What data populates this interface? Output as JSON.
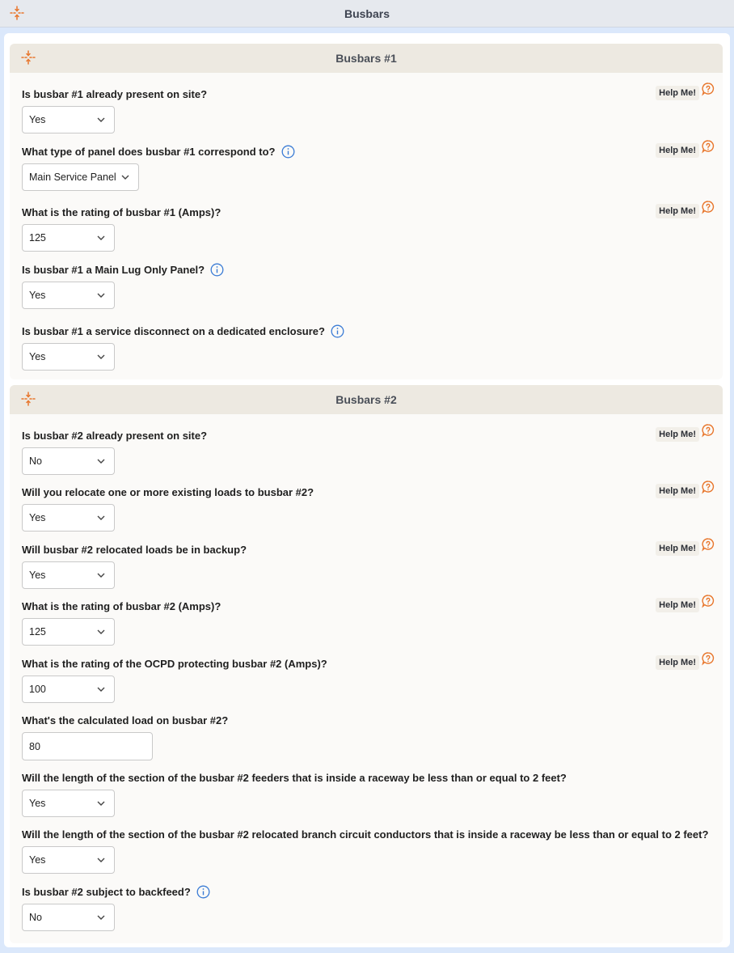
{
  "page": {
    "title": "Busbars"
  },
  "help_label": "Help Me!",
  "sections": [
    {
      "title": "Busbars #1",
      "questions": [
        {
          "label": "Is busbar #1 already present on site?",
          "value": "Yes",
          "help": true,
          "info": false
        },
        {
          "label": "What type of panel does busbar #1 correspond to?",
          "value": "Main Service Panel",
          "help": true,
          "info": true
        },
        {
          "label": "What is the rating of busbar #1 (Amps)?",
          "value": "125",
          "help": true,
          "info": false
        },
        {
          "label": "Is busbar #1 a Main Lug Only Panel?",
          "value": "Yes",
          "help": false,
          "info": true
        },
        {
          "label": "Is busbar #1 a service disconnect on a dedicated enclosure?",
          "value": "Yes",
          "help": false,
          "info": true
        }
      ]
    },
    {
      "title": "Busbars #2",
      "questions": [
        {
          "label": "Is busbar #2 already present on site?",
          "value": "No",
          "help": true,
          "info": false
        },
        {
          "label": "Will you relocate one or more existing loads to busbar #2?",
          "value": "Yes",
          "help": true,
          "info": false
        },
        {
          "label": "Will busbar #2 relocated loads be in backup?",
          "value": "Yes",
          "help": true,
          "info": false
        },
        {
          "label": "What is the rating of busbar #2 (Amps)?",
          "value": "125",
          "help": true,
          "info": false
        },
        {
          "label": "What is the rating of the OCPD protecting busbar #2 (Amps)?",
          "value": "100",
          "help": true,
          "info": false
        },
        {
          "label": "What's the calculated load on busbar #2?",
          "value": "80",
          "help": false,
          "info": false,
          "input_type": "text"
        },
        {
          "label": "Will the length of the section of the busbar #2 feeders that is inside a raceway be less than or equal to 2 feet?",
          "value": "Yes",
          "help": false,
          "info": false
        },
        {
          "label": "Will the length of the section of the busbar #2 relocated branch circuit conductors that is inside a raceway be less than or equal to 2 feet?",
          "value": "Yes",
          "help": false,
          "info": false
        },
        {
          "label": "Is busbar #2 subject to backfeed?",
          "value": "No",
          "help": false,
          "info": true
        }
      ]
    }
  ],
  "colors": {
    "accent_orange": "#e8762c",
    "info_blue": "#3a7bd5",
    "section_header_bg": "#ede9e1",
    "page_bg": "#dbe8fb"
  },
  "icons": {
    "collapse": "collapse-arrows-icon",
    "info": "info-circle-icon",
    "help": "help-bubble-icon",
    "dropdown": "chevron-down-icon"
  }
}
